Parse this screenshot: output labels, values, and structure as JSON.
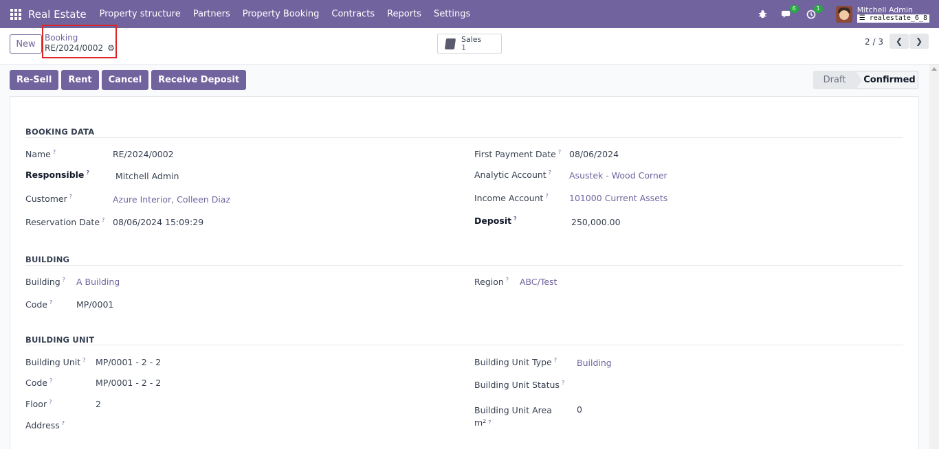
{
  "topbar": {
    "brand": "Real Estate",
    "menu": [
      "Property structure",
      "Partners",
      "Property Booking",
      "Contracts",
      "Reports",
      "Settings"
    ],
    "messages_badge": "6",
    "activity_badge": "1",
    "user_name": "Mitchell Admin",
    "db_name": "realestate_6_8"
  },
  "control": {
    "new_label": "New",
    "breadcrumb_parent": "Booking",
    "breadcrumb_current": "RE/2024/0002",
    "smart_label": "Sales",
    "smart_value": "1",
    "pager": "2 / 3"
  },
  "actions": [
    "Re-Sell",
    "Rent",
    "Cancel",
    "Receive Deposit"
  ],
  "status": {
    "draft": "Draft",
    "confirmed": "Confirmed"
  },
  "help_mark": "?",
  "booking": {
    "title": "BOOKING DATA",
    "name_label": "Name",
    "name": "RE/2024/0002",
    "responsible_label": "Responsible",
    "responsible": "Mitchell Admin",
    "customer_label": "Customer",
    "customer": "Azure Interior, Colleen Diaz",
    "reservation_label": "Reservation Date",
    "reservation": "08/06/2024 15:09:29",
    "first_payment_label": "First Payment Date",
    "first_payment": "08/06/2024",
    "analytic_label": "Analytic Account",
    "analytic": "Asustek - Wood Corner",
    "income_label": "Income Account",
    "income": "101000 Current Assets",
    "deposit_label": "Deposit",
    "deposit": "250,000.00"
  },
  "building": {
    "title": "BUILDING",
    "building_label": "Building",
    "building": "A Building",
    "code_label": "Code",
    "code": "MP/0001",
    "region_label": "Region",
    "region": "ABC/Test"
  },
  "unit": {
    "title": "BUILDING UNIT",
    "unit_label": "Building Unit",
    "unit": "MP/0001 - 2 - 2",
    "code_label": "Code",
    "code": "MP/0001 - 2 - 2",
    "floor_label": "Floor",
    "floor": "2",
    "address_label": "Address",
    "type_label": "Building Unit Type",
    "type": "Building",
    "status_label": "Building Unit Status",
    "area_label_1": "Building Unit Area",
    "area_label_2": "m²",
    "area": "0"
  }
}
